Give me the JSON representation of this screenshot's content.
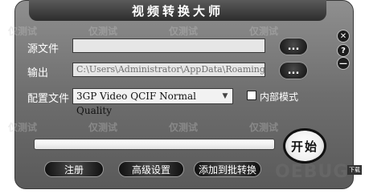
{
  "window": {
    "title": "视频转换大师"
  },
  "source": {
    "label": "源文件",
    "value": "",
    "browse_label": "..."
  },
  "output": {
    "label": "输出",
    "value": "C:\\Users\\Administrator\\AppData\\Roaming",
    "browse_label": "..."
  },
  "config": {
    "label": "配置文件",
    "selected": "3GP Video QCIF Normal Quality",
    "internal_mode_label": "内部模式",
    "internal_mode_checked": false
  },
  "progress": {
    "value": 0
  },
  "buttons": {
    "start": "开始",
    "register": "注册",
    "advanced": "高级设置",
    "add_batch": "添加到批转换"
  },
  "controls": {
    "close_icon": "close-icon",
    "help_icon": "help-icon",
    "minimize_icon": "minimize-icon"
  },
  "watermark": {
    "text": "仅测试",
    "logo": "OEBUG",
    "logo_suffix": "下载"
  }
}
